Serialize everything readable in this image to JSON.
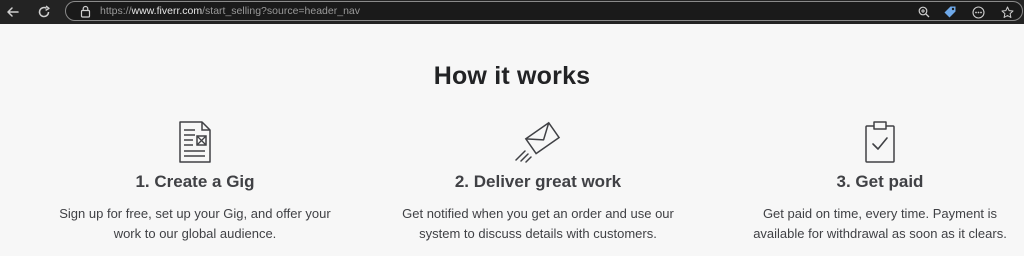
{
  "browser": {
    "url_prefix": "https://",
    "url_host": "www.fiverr.com",
    "url_path": "/start_selling?source=header_nav",
    "icons": {
      "back": "back-arrow-icon",
      "reload": "reload-icon",
      "lock": "lock-icon",
      "zoom": "zoom-icon",
      "tag": "tag-icon",
      "more": "more-icon",
      "favorite": "star-icon"
    }
  },
  "section": {
    "title": "How it works",
    "steps": [
      {
        "icon": "document-icon",
        "title": "1. Create a Gig",
        "desc_line1": "Sign up for free, set up your Gig, and offer your",
        "desc_line2": "work to our global audience."
      },
      {
        "icon": "paper-plane-envelope-icon",
        "title": "2. Deliver great work",
        "desc_line1": "Get notified when you get an order and use our",
        "desc_line2": "system to discuss details with customers."
      },
      {
        "icon": "clipboard-check-icon",
        "title": "3. Get paid",
        "desc_line1": "Get paid on time, every time. Payment is",
        "desc_line2": "available for withdrawal as soon as it clears."
      }
    ]
  },
  "colors": {
    "page_bg": "#f7f7f7",
    "heading": "#222325",
    "text": "#404145",
    "chrome_bg": "#232323",
    "tag_icon": "#6ea8e8"
  }
}
